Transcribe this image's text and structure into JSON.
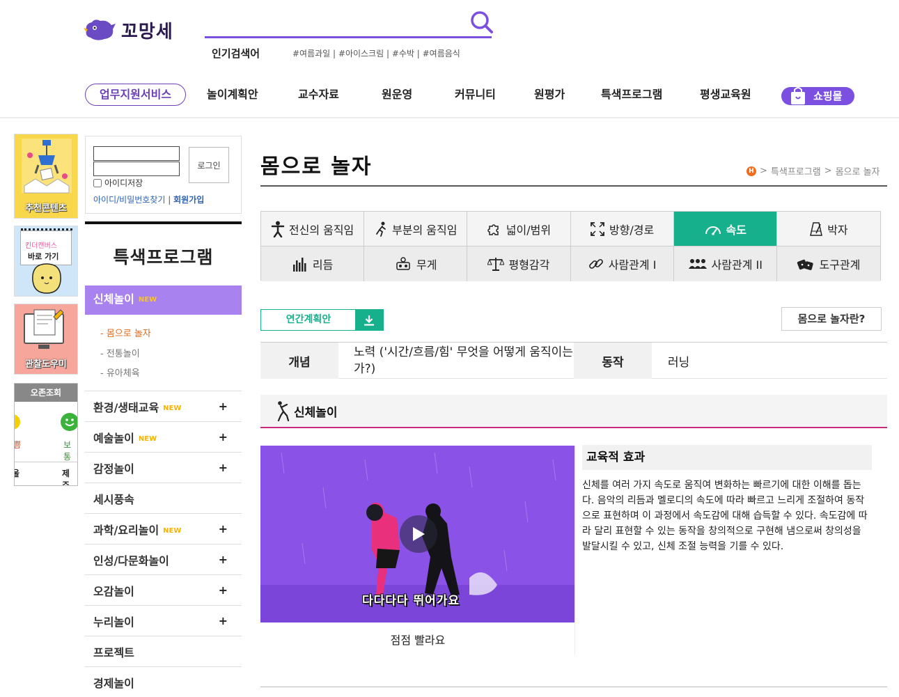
{
  "header": {
    "logo": "꼬망세",
    "search": {
      "value": "",
      "placeholder": ""
    },
    "popular_label": "인기검색어",
    "popular_tags": "#여름과일 | #아이스크림 | #수박 | #여름음식"
  },
  "nav": {
    "items": [
      "업무지원서비스",
      "놀이계획안",
      "교수자료",
      "원운영",
      "커뮤니티",
      "원평가",
      "특색프로그램",
      "평생교육원",
      "쇼핑몰"
    ]
  },
  "banners": {
    "recommend": "추천콘텐츠",
    "kinder_line1": "킨더캔버스",
    "kinder_line2": "바로 가기",
    "observe": "관찰도우미",
    "ozone_title": "오존조회",
    "ozone_label_a": "보통",
    "ozone_label_b": "제주",
    "ozone_left_a": "쁨",
    "ozone_left_b": "울"
  },
  "login": {
    "button": "로그인",
    "save_id": "아이디저장",
    "find": "아이디/비밀번호찾기",
    "sep": "|",
    "join": "회원가입"
  },
  "side": {
    "title": "특색프로그램",
    "active": "신체놀이",
    "new_tag": "NEW",
    "sub": [
      "- 몸으로 놀자",
      "- 전통놀이",
      "- 유아체육"
    ],
    "menu": [
      {
        "label": "환경/생태교육",
        "new": true,
        "plus": true
      },
      {
        "label": "예술놀이",
        "new": true,
        "plus": true
      },
      {
        "label": "감정놀이",
        "new": false,
        "plus": true
      },
      {
        "label": "세시풍속",
        "new": false,
        "plus": false
      },
      {
        "label": "과학/요리놀이",
        "new": true,
        "plus": true
      },
      {
        "label": "인성/다문화놀이",
        "new": false,
        "plus": true
      },
      {
        "label": "오감놀이",
        "new": false,
        "plus": true
      },
      {
        "label": "누리놀이",
        "new": false,
        "plus": true
      },
      {
        "label": "프로젝트",
        "new": false,
        "plus": false
      },
      {
        "label": "경제놀이",
        "new": false,
        "plus": false
      }
    ],
    "plus_sign": "+"
  },
  "main": {
    "title": "몸으로 놀자",
    "breadcrumb": {
      "home": "H",
      "sep": ">",
      "parent": "특색프로그램",
      "current": "몸으로 놀자"
    },
    "tabs": [
      {
        "label": "전신의 움직임",
        "icon": "person-icon"
      },
      {
        "label": "부분의 움직임",
        "icon": "running-icon"
      },
      {
        "label": "넓이/범위",
        "icon": "puzzle-icon"
      },
      {
        "label": "방향/경로",
        "icon": "expand-icon"
      },
      {
        "label": "속도",
        "icon": "speedometer-icon",
        "active": true
      },
      {
        "label": "박자",
        "icon": "metronome-icon"
      },
      {
        "label": "리듬",
        "icon": "equalizer-icon"
      },
      {
        "label": "무게",
        "icon": "weight-icon"
      },
      {
        "label": "평형감각",
        "icon": "balance-icon"
      },
      {
        "label": "사람관계 I",
        "icon": "link-icon"
      },
      {
        "label": "사람관계 II",
        "icon": "people-icon"
      },
      {
        "label": "도구관계",
        "icon": "dice-icon"
      }
    ],
    "annual_plan": "연간계획안",
    "what_is": "몸으로 놀자란?",
    "info": {
      "concept_label": "개념",
      "concept_value": "노력 ('시간/흐름/힘' 무엇을 어떻게 움직이는가?)",
      "action_label": "동작",
      "action_value": "러닝"
    },
    "section_title": "신체놀이",
    "video": {
      "caption": "다다다다 뛰어가요",
      "title": "점점 빨라요"
    },
    "effect": {
      "title": "교육적 효과",
      "body": "신체를 여러 가지 속도로 움직여 변화하는 빠르기에 대한 이해를 돕는다. 음악의 리듬과 멜로디의 속도에 따라 빠르고 느리게 조절하여 동작으로 표현하며 이 과정에서 속도감에 대해 습득할 수 있다. 속도감에 따라 달리 표현할 수 있는 동작을 창의적으로 구현해 냄으로써 창의성을 발달시킬 수 있고, 신체 조절 능력을 기를 수 있다."
    }
  },
  "colors": {
    "accent_purple": "#7b4fe0",
    "active_green": "#16b08c",
    "side_active": "#a882ee",
    "section_rule": "#c62a7e"
  }
}
